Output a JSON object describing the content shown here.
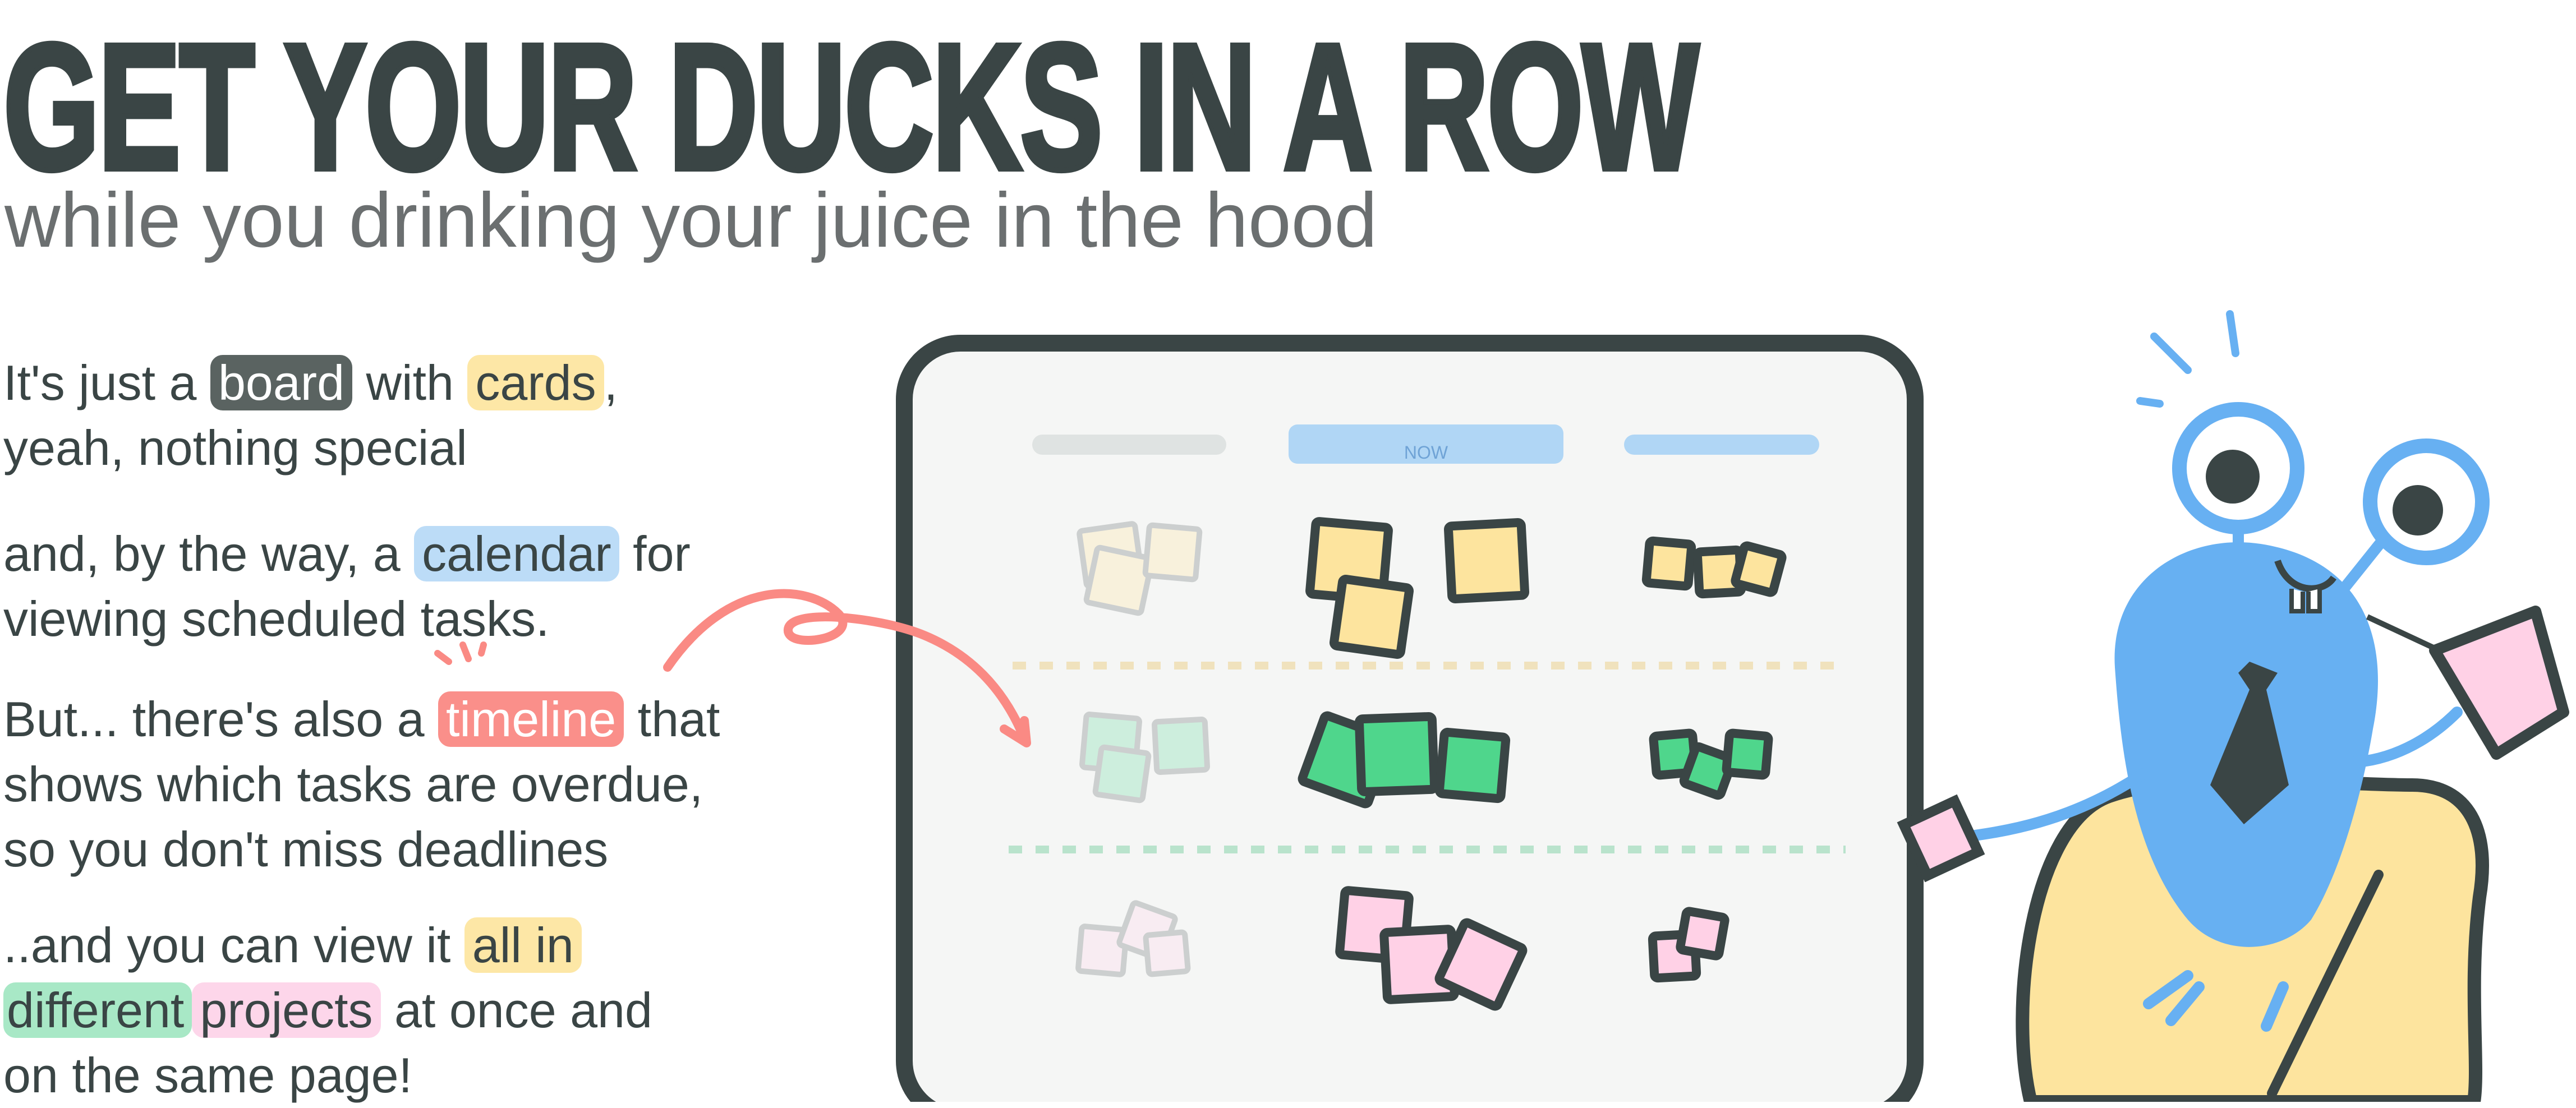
{
  "header": {
    "title": "GET YOUR DUCKS IN A ROW",
    "subtitle": "while you drinking your juice in the hood"
  },
  "paragraphs": {
    "p1": {
      "a": "It's just a ",
      "board": "board",
      "b": " with ",
      "cards": "cards",
      "c": ",",
      "d": "yeah, nothing special"
    },
    "p2": {
      "a": "and, by the way, a ",
      "calendar": "calendar",
      "b": " for",
      "c": "viewing scheduled tasks."
    },
    "p3": {
      "a": "But... there's also a ",
      "timeline": "timeline",
      "b": " that",
      "c": "shows which tasks are overdue,",
      "d": "so you don't miss deadlines"
    },
    "p4": {
      "a": "..and you can view it ",
      "all_in": "all in",
      "different": "different",
      "projects": "projects",
      "b": " at once and",
      "c": "on the same page!"
    }
  },
  "board": {
    "now_label": "NOW"
  },
  "colors": {
    "text": "#3a4545",
    "yellow": "#fde49e",
    "green": "#4fd68c",
    "pink": "#ffd1e6",
    "blue": "#67b0f2",
    "coral": "#fa8a84"
  }
}
